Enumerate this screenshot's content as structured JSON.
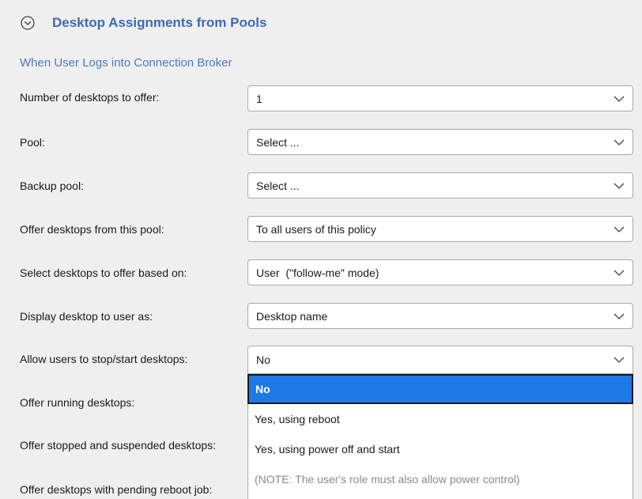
{
  "section": {
    "title": "Desktop Assignments from Pools",
    "subheading": "When User Logs into Connection Broker"
  },
  "fields": [
    {
      "label": "Number of desktops to offer:",
      "value": "1"
    },
    {
      "label": "Pool:",
      "value": "Select ..."
    },
    {
      "label": "Backup pool:",
      "value": "Select ..."
    },
    {
      "label": "Offer desktops from this pool:",
      "value": "To all users of this policy"
    },
    {
      "label": "Select desktops to offer based on:",
      "value": "User  (\"follow-me\" mode)"
    },
    {
      "label": "Display desktop to user as:",
      "value": "Desktop name"
    },
    {
      "label": "Allow users to stop/start desktops:",
      "value": "No"
    },
    {
      "label": "Offer running desktops:"
    },
    {
      "label": "Offer stopped and suspended desktops:"
    },
    {
      "label": "Offer desktops with pending reboot job:"
    }
  ],
  "dropdown": {
    "options": [
      "No",
      "Yes, using reboot",
      "Yes, using power off and start",
      "(NOTE: The user's role must also allow power control)"
    ],
    "selected": "No"
  },
  "icons": {
    "collapse": "chevron-circle-icon",
    "select_arrow": "chevron-down-icon"
  },
  "colors": {
    "title": "#3d6bb3",
    "subheading": "#4d79be",
    "selected_option": "#1e7ae6",
    "background": "#efefef"
  }
}
